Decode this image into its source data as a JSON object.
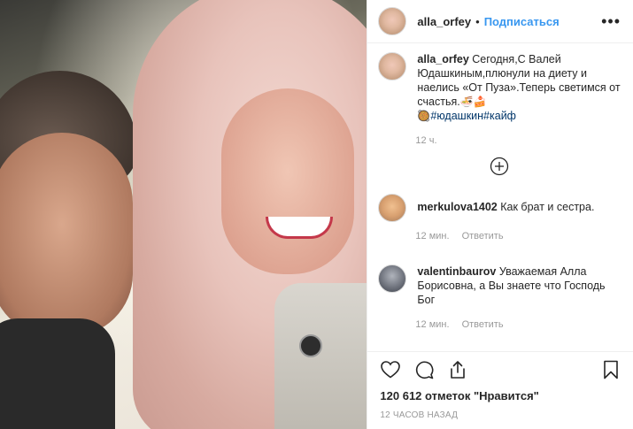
{
  "post": {
    "author": "alla_orfey",
    "separator": "•",
    "follow_label": "Подписаться",
    "more_label": "•••",
    "caption_text": "Сегодня,С Валей Юдашкиным,плюнули на диету и наелись «От Пуза».Теперь светимся от счастья.",
    "caption_tags": "#юдашкин#кайф",
    "caption_emojis": "🍜🍰",
    "caption_emoji2": "🥘",
    "caption_time": "12 ч."
  },
  "comments": [
    {
      "user": "merkulova1402",
      "text": "Как брат и сестра.",
      "time": "12 мин.",
      "reply_label": "Ответить"
    },
    {
      "user": "valentinbaurov",
      "text": "Уважаемая Алла Борисовна, а Вы знаете что Господь Бог",
      "time": "12 мин.",
      "reply_label": "Ответить"
    }
  ],
  "footer": {
    "likes": "120 612 отметок \"Нравится\"",
    "date": "12 ЧАСОВ НАЗАД"
  },
  "icons": {
    "like": "heart-icon",
    "comment": "comment-icon",
    "share": "share-icon",
    "save": "bookmark-icon",
    "load_more": "plus-circle-icon"
  },
  "colors": {
    "link": "#3897f0",
    "tag": "#003569",
    "muted": "#999999"
  }
}
